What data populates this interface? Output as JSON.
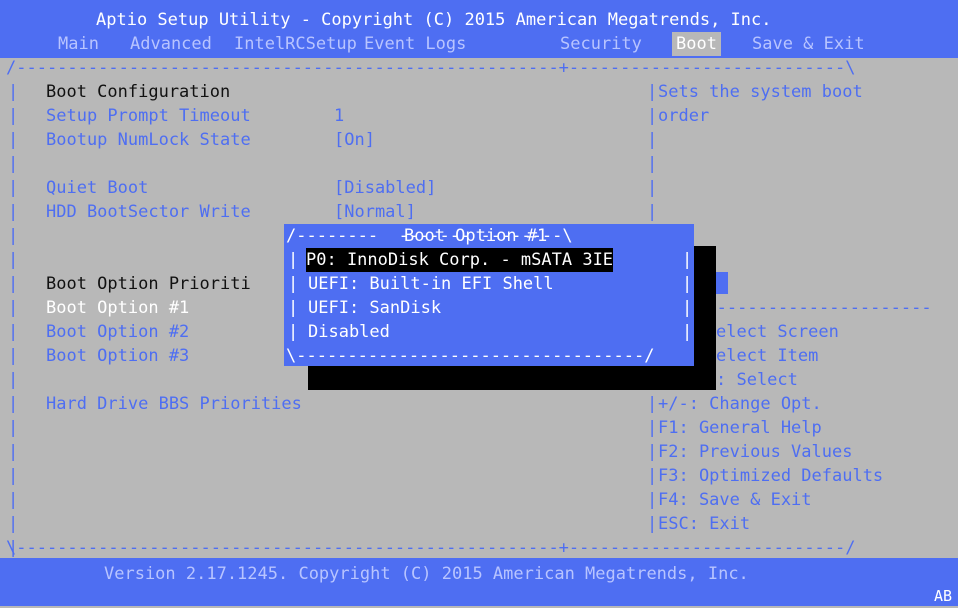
{
  "header": {
    "title": "Aptio Setup Utility - Copyright (C) 2015 American Megatrends, Inc."
  },
  "tabs": [
    {
      "label": "Main",
      "active": false
    },
    {
      "label": "Advanced",
      "active": false
    },
    {
      "label": "IntelRCSetup",
      "active": false
    },
    {
      "label": "Event Logs",
      "active": false
    },
    {
      "label": "Security",
      "active": false
    },
    {
      "label": "Boot",
      "active": true
    },
    {
      "label": "Save & Exit",
      "active": false
    }
  ],
  "main": {
    "section_title": "Boot Configuration",
    "setup_prompt_timeout": {
      "label": "Setup Prompt Timeout",
      "value": "1"
    },
    "bootup_numlock": {
      "label": "Bootup NumLock State",
      "value": "[On]"
    },
    "quiet_boot": {
      "label": "Quiet Boot",
      "value": "[Disabled]"
    },
    "hdd_bootsector": {
      "label": "HDD BootSector Write",
      "value": "[Normal]"
    },
    "priorities_title": "Boot Option Prioriti",
    "boot_option_1": "Boot Option #1",
    "boot_option_2": "Boot Option #2",
    "boot_option_3": "Boot Option #3",
    "hdd_bbs": "Hard Drive BBS Priorities"
  },
  "help": {
    "line1": "Sets the system boot",
    "line2": "order"
  },
  "keys": [
    "elect Screen",
    "elect Item",
    ": Select",
    "+/-: Change Opt.",
    "F1: General Help",
    "F2: Previous Values",
    "F3: Optimized Defaults",
    "F4: Save & Exit",
    "ESC: Exit"
  ],
  "popup": {
    "title": "Boot Option #1",
    "options": [
      "P0: InnoDisk Corp. - mSATA 3IE",
      "UEFI: Built-in EFI Shell",
      "UEFI: SanDisk",
      "Disabled"
    ],
    "selected_index": 0
  },
  "footer": {
    "version": "Version 2.17.1245. Copyright (C) 2015 American Megatrends, Inc.",
    "badge": "AB"
  },
  "colors": {
    "blue": "#4e6ef2",
    "gray": "#b8b8b8",
    "text_dark": "#111111",
    "white": "#ffffff"
  }
}
